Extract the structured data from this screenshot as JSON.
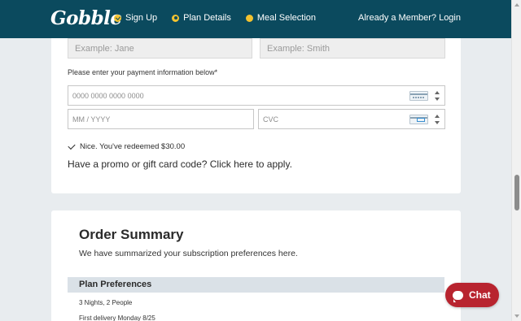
{
  "header": {
    "logo": "Gobble",
    "steps": [
      {
        "label": "Sign Up",
        "status": "complete",
        "icon": "check-circle-icon"
      },
      {
        "label": "Plan Details",
        "status": "current",
        "icon": "ring-circle-icon"
      },
      {
        "label": "Meal Selection",
        "status": "upcoming",
        "icon": "dot-circle-icon"
      }
    ],
    "login_link": "Already a Member? Login"
  },
  "payment": {
    "first_name_placeholder": "Example: Jane",
    "last_name_placeholder": "Example: Smith",
    "payment_label": "Please enter your payment information below*",
    "card_number_placeholder": "0000 0000 0000 0000",
    "expiry_placeholder": "MM / YYYY",
    "cvc_placeholder": "CVC",
    "redeem_message": "Nice. You've redeemed $30.00",
    "promo_link": "Have a promo or gift card code? Click here to apply."
  },
  "order_summary": {
    "title": "Order Summary",
    "subtitle": "We have summarized your subscription preferences here.",
    "section_title": "Plan Preferences",
    "items": [
      "3 Nights, 2 People",
      "First delivery Monday 8/25"
    ]
  },
  "chat": {
    "label": "Chat"
  },
  "colors": {
    "header_bg": "#0b4a5e",
    "step_accent": "#f2c230",
    "chat_button": "#b8242f",
    "section_bar": "#dae1e7",
    "page_bg": "#e8ecef"
  }
}
